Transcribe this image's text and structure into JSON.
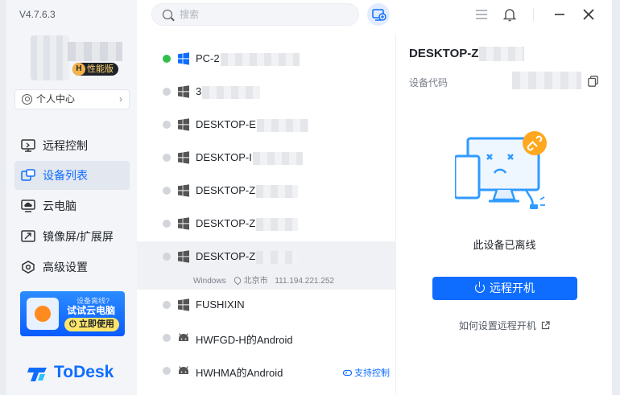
{
  "app": {
    "version": "V4.7.6.3",
    "brand": "ToDesk",
    "accent": "#0e6dff"
  },
  "user": {
    "badge_letter": "H",
    "badge_label": "性能版",
    "center_label": "个人中心"
  },
  "nav": [
    {
      "id": "remote",
      "label": "远程控制",
      "icon": "monitor-remote-icon",
      "active": false
    },
    {
      "id": "devices",
      "label": "设备列表",
      "icon": "device-list-icon",
      "active": true
    },
    {
      "id": "cloud",
      "label": "云电脑",
      "icon": "cloud-pc-icon",
      "active": false
    },
    {
      "id": "mirror",
      "label": "镜像屏/扩展屏",
      "icon": "mirror-screen-icon",
      "active": false
    },
    {
      "id": "advanced",
      "label": "高级设置",
      "icon": "gear-icon",
      "active": false
    }
  ],
  "promo": {
    "line1": "设备离线?",
    "line2": "试试云电脑",
    "button": "立即使用"
  },
  "search": {
    "placeholder": "搜索"
  },
  "devices": [
    {
      "name": "PC-2",
      "os": "windows",
      "online": true
    },
    {
      "name": "3",
      "os": "windows",
      "online": false
    },
    {
      "name": "DESKTOP-E",
      "os": "windows",
      "online": false
    },
    {
      "name": "DESKTOP-I",
      "os": "windows",
      "online": false
    },
    {
      "name": "DESKTOP-Z",
      "os": "windows",
      "online": false
    },
    {
      "name": "DESKTOP-Z",
      "os": "windows",
      "online": false
    },
    {
      "name": "DESKTOP-Z",
      "os": "windows",
      "online": false,
      "selected": true,
      "os_label": "Windows",
      "location": "北京市",
      "ip": "111.194.221.252"
    },
    {
      "name": "FUSHIXIN",
      "os": "windows",
      "online": false
    },
    {
      "name": "HWFGD-H的Android",
      "os": "android",
      "online": false
    },
    {
      "name": "HWHMA的Android",
      "os": "android",
      "online": false,
      "tag": "支持控制"
    }
  ],
  "detail": {
    "title": "DESKTOP-Z",
    "code_label": "设备代码",
    "offline_text": "此设备已离线",
    "power_button": "远程开机",
    "help_link": "如何设置远程开机"
  }
}
